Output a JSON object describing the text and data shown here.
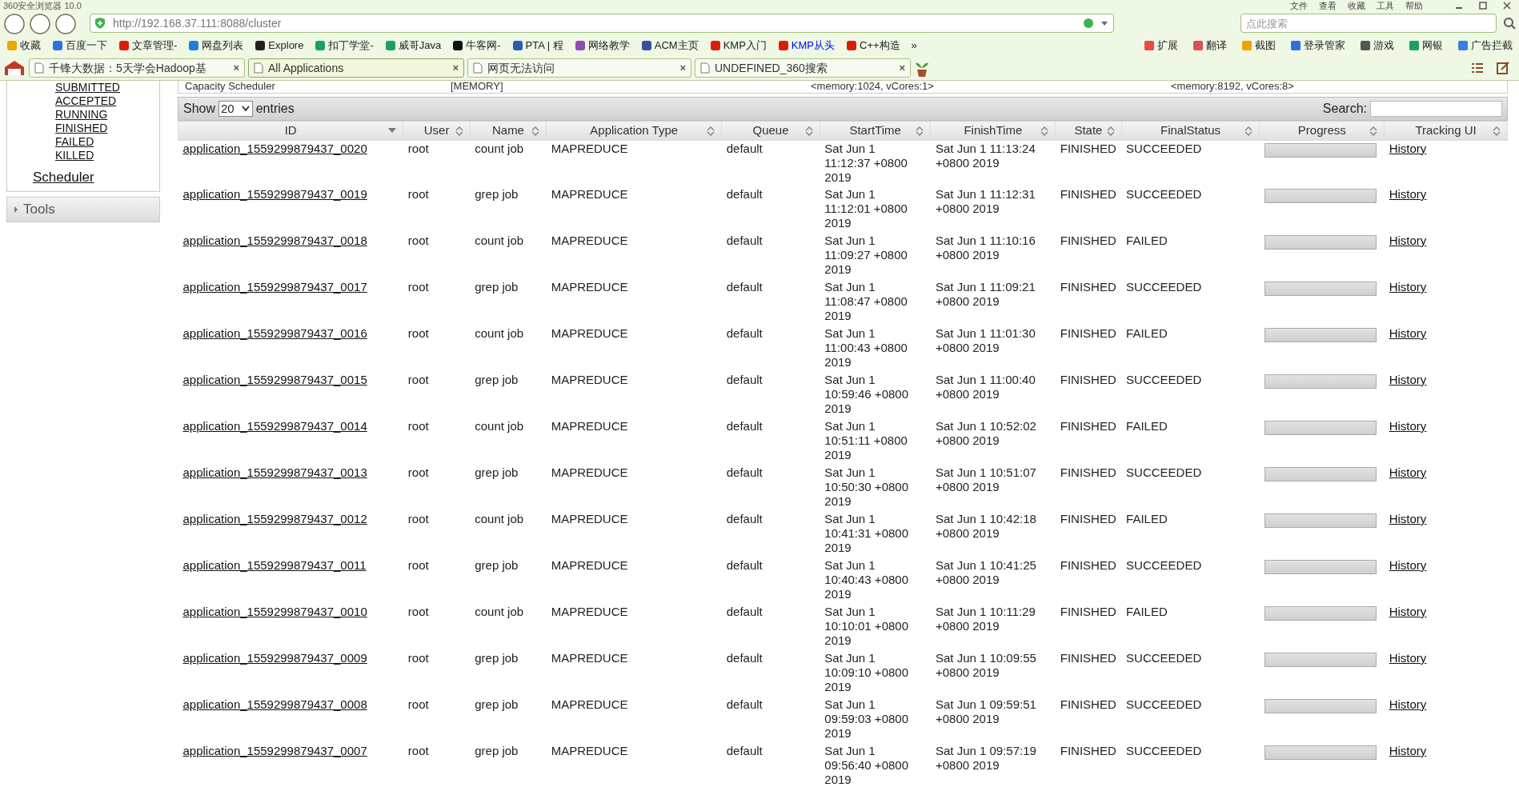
{
  "window": {
    "title": "360安全浏览器 10.0",
    "menu": [
      "文件",
      "查看",
      "收藏",
      "工具",
      "帮助"
    ]
  },
  "address_bar": {
    "url": "http://192.168.37.111:8088/cluster"
  },
  "search_box": {
    "placeholder": "点此搜索"
  },
  "bookmarks": [
    {
      "label": "收藏",
      "highlighted": false,
      "color": "#e8a800"
    },
    {
      "label": "百度一下",
      "highlighted": false,
      "color": "#2f6fe0"
    },
    {
      "label": "文章管理-",
      "highlighted": false,
      "color": "#d81e06"
    },
    {
      "label": "网盘列表",
      "highlighted": false,
      "color": "#1e7fd8"
    },
    {
      "label": "Explore",
      "highlighted": false,
      "color": "#222222"
    },
    {
      "label": "扣丁学堂-",
      "highlighted": false,
      "color": "#1aa15f"
    },
    {
      "label": "威哥Java",
      "highlighted": false,
      "color": "#1aa15f"
    },
    {
      "label": "牛客网-",
      "highlighted": false,
      "color": "#111111"
    },
    {
      "label": "PTA | 程",
      "highlighted": false,
      "color": "#2a5db0"
    },
    {
      "label": "网络教学",
      "highlighted": false,
      "color": "#8a4fb0"
    },
    {
      "label": "ACM主页",
      "highlighted": false,
      "color": "#3a4fa0"
    },
    {
      "label": "KMP入门",
      "highlighted": false,
      "color": "#d81e06"
    },
    {
      "label": "KMP从头",
      "highlighted": true,
      "color": "#d81e06"
    },
    {
      "label": "C++构造",
      "highlighted": false,
      "color": "#d81e06"
    }
  ],
  "bookmarks_more": "»",
  "tools": [
    {
      "label": "扩展",
      "color": "#e84c3d"
    },
    {
      "label": "翻译",
      "color": "#d9534f"
    },
    {
      "label": "截图",
      "color": "#e8a800"
    },
    {
      "label": "登录管家",
      "color": "#2f6fe0"
    },
    {
      "label": "游戏",
      "color": "#555555"
    },
    {
      "label": "网银",
      "color": "#1aa15f"
    },
    {
      "label": "广告拦截",
      "color": "#3a7fd8"
    }
  ],
  "tabs": [
    {
      "label": "千锋大数据：5天学会Hadoop基",
      "close": "×",
      "selected": false
    },
    {
      "label": "All Applications",
      "close": "×",
      "selected": true
    },
    {
      "label": "网页无法访问",
      "close": "×",
      "selected": false
    },
    {
      "label": "UNDEFINED_360搜索",
      "close": "×",
      "selected": false
    }
  ],
  "sidebar": {
    "items": [
      "SUBMITTED",
      "ACCEPTED",
      "RUNNING",
      "FINISHED",
      "FAILED",
      "KILLED"
    ],
    "scheduler": "Scheduler",
    "tools": "Tools"
  },
  "scheduler_info": [
    "Capacity Scheduler",
    "[MEMORY]",
    "<memory:1024, vCores:1>",
    "<memory:8192, vCores:8>"
  ],
  "table_controls": {
    "show": "Show",
    "entries_value": "20",
    "entries": "entries",
    "search_label": "Search:"
  },
  "table": {
    "columns": [
      {
        "label": "ID",
        "sorted": true
      },
      {
        "label": "User",
        "sorted": false
      },
      {
        "label": "Name",
        "sorted": false
      },
      {
        "label": "Application Type",
        "sorted": false
      },
      {
        "label": "Queue",
        "sorted": false
      },
      {
        "label": "StartTime",
        "sorted": false
      },
      {
        "label": "FinishTime",
        "sorted": false
      },
      {
        "label": "State",
        "sorted": false
      },
      {
        "label": "FinalStatus",
        "sorted": false
      },
      {
        "label": "Progress",
        "sorted": false
      },
      {
        "label": "Tracking UI",
        "sorted": false
      }
    ],
    "rows": [
      {
        "id": "application_1559299879437_0020",
        "user": "root",
        "name": "count job",
        "type": "MAPREDUCE",
        "queue": "default",
        "start": "Sat Jun 1 11:12:37 +0800 2019",
        "finish": "Sat Jun 1 11:13:24 +0800 2019",
        "state": "FINISHED",
        "final_status": "SUCCEEDED",
        "level": 1,
        "tracking": "History"
      },
      {
        "id": "application_1559299879437_0019",
        "user": "root",
        "name": "grep job",
        "type": "MAPREDUCE",
        "queue": "default",
        "start": "Sat Jun 1 11:12:01 +0800 2019",
        "finish": "Sat Jun 1 11:12:31 +0800 2019",
        "state": "FINISHED",
        "final_status": "SUCCEEDED",
        "level": 1,
        "tracking": "History"
      },
      {
        "id": "application_1559299879437_0018",
        "user": "root",
        "name": "count job",
        "type": "MAPREDUCE",
        "queue": "default",
        "start": "Sat Jun 1 11:09:27 +0800 2019",
        "finish": "Sat Jun 1 11:10:16 +0800 2019",
        "state": "FINISHED",
        "final_status": "FAILED",
        "level": 1,
        "tracking": "History"
      },
      {
        "id": "application_1559299879437_0017",
        "user": "root",
        "name": "grep job",
        "type": "MAPREDUCE",
        "queue": "default",
        "start": "Sat Jun 1 11:08:47 +0800 2019",
        "finish": "Sat Jun 1 11:09:21 +0800 2019",
        "state": "FINISHED",
        "final_status": "SUCCEEDED",
        "level": 1,
        "tracking": "History"
      },
      {
        "id": "application_1559299879437_0016",
        "user": "root",
        "name": "count job",
        "type": "MAPREDUCE",
        "queue": "default",
        "start": "Sat Jun 1 11:00:43 +0800 2019",
        "finish": "Sat Jun 1 11:01:30 +0800 2019",
        "state": "FINISHED",
        "final_status": "FAILED",
        "level": 1,
        "tracking": "History"
      },
      {
        "id": "application_1559299879437_0015",
        "user": "root",
        "name": "grep job",
        "type": "MAPREDUCE",
        "queue": "default",
        "start": "Sat Jun 1 10:59:46 +0800 2019",
        "finish": "Sat Jun 1 11:00:40 +0800 2019",
        "state": "FINISHED",
        "final_status": "SUCCEEDED",
        "level": 1,
        "tracking": "History"
      },
      {
        "id": "application_1559299879437_0014",
        "user": "root",
        "name": "count job",
        "type": "MAPREDUCE",
        "queue": "default",
        "start": "Sat Jun 1 10:51:11 +0800 2019",
        "finish": "Sat Jun 1 10:52:02 +0800 2019",
        "state": "FINISHED",
        "final_status": "FAILED",
        "level": 1,
        "tracking": "History"
      },
      {
        "id": "application_1559299879437_0013",
        "user": "root",
        "name": "grep job",
        "type": "MAPREDUCE",
        "queue": "default",
        "start": "Sat Jun 1 10:50:30 +0800 2019",
        "finish": "Sat Jun 1 10:51:07 +0800 2019",
        "state": "FINISHED",
        "final_status": "SUCCEEDED",
        "level": 1,
        "tracking": "History"
      },
      {
        "id": "application_1559299879437_0012",
        "user": "root",
        "name": "count job",
        "type": "MAPREDUCE",
        "queue": "default",
        "start": "Sat Jun 1 10:41:31 +0800 2019",
        "finish": "Sat Jun 1 10:42:18 +0800 2019",
        "state": "FINISHED",
        "final_status": "FAILED",
        "level": 1,
        "tracking": "History"
      },
      {
        "id": "application_1559299879437_0011",
        "user": "root",
        "name": "grep job",
        "type": "MAPREDUCE",
        "queue": "default",
        "start": "Sat Jun 1 10:40:43 +0800 2019",
        "finish": "Sat Jun 1 10:41:25 +0800 2019",
        "state": "FINISHED",
        "final_status": "SUCCEEDED",
        "level": 1,
        "tracking": "History"
      },
      {
        "id": "application_1559299879437_0010",
        "user": "root",
        "name": "count job",
        "type": "MAPREDUCE",
        "queue": "default",
        "start": "Sat Jun 1 10:10:01 +0800 2019",
        "finish": "Sat Jun 1 10:11:29 +0800 2019",
        "state": "FINISHED",
        "final_status": "FAILED",
        "level": 1,
        "tracking": "History"
      },
      {
        "id": "application_1559299879437_0009",
        "user": "root",
        "name": "grep job",
        "type": "MAPREDUCE",
        "queue": "default",
        "start": "Sat Jun 1 10:09:10 +0800 2019",
        "finish": "Sat Jun 1 10:09:55 +0800 2019",
        "state": "FINISHED",
        "final_status": "SUCCEEDED",
        "level": 1,
        "tracking": "History"
      },
      {
        "id": "application_1559299879437_0008",
        "user": "root",
        "name": "grep job",
        "type": "MAPREDUCE",
        "queue": "default",
        "start": "Sat Jun 1 09:59:03 +0800 2019",
        "finish": "Sat Jun 1 09:59:51 +0800 2019",
        "state": "FINISHED",
        "final_status": "SUCCEEDED",
        "level": 1,
        "tracking": "History"
      },
      {
        "id": "application_1559299879437_0007",
        "user": "root",
        "name": "grep job",
        "type": "MAPREDUCE",
        "queue": "default",
        "start": "Sat Jun 1 09:56:40 +0800 2019",
        "finish": "Sat Jun 1 09:57:19 +0800 2019",
        "state": "FINISHED",
        "final_status": "SUCCEEDED",
        "level": 1,
        "tracking": "History"
      }
    ]
  }
}
